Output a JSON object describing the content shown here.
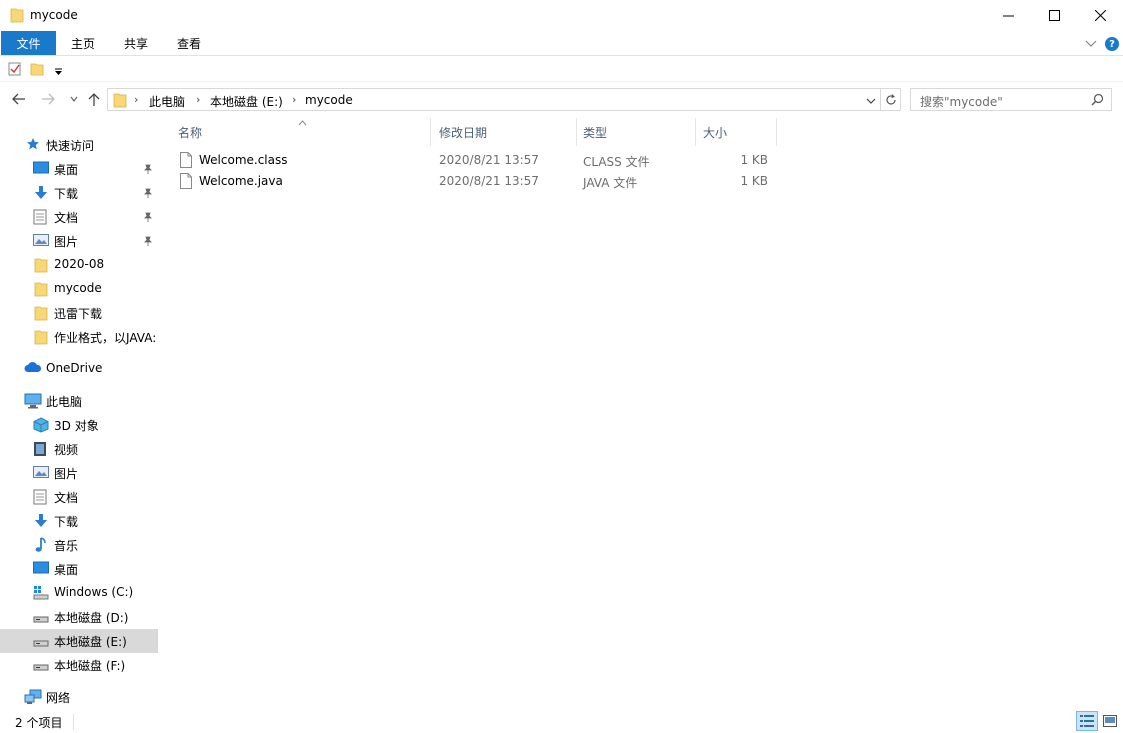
{
  "window": {
    "title": "mycode"
  },
  "ribbon": {
    "tabs": [
      {
        "label": "文件"
      },
      {
        "label": "主页"
      },
      {
        "label": "共享"
      },
      {
        "label": "查看"
      }
    ],
    "help_label": "?"
  },
  "address": {
    "crumbs": [
      "此电脑",
      "本地磁盘 (E:)",
      "mycode"
    ]
  },
  "search": {
    "placeholder": "搜索\"mycode\""
  },
  "sidebar": {
    "quick_access_label": "快速访问",
    "quick_items": [
      {
        "label": "桌面",
        "icon": "desktop-icon",
        "pinned": true
      },
      {
        "label": "下载",
        "icon": "download-icon",
        "pinned": true
      },
      {
        "label": "文档",
        "icon": "documents-icon",
        "pinned": true
      },
      {
        "label": "图片",
        "icon": "pictures-icon",
        "pinned": true
      },
      {
        "label": "2020-08",
        "icon": "folder-icon",
        "pinned": false
      },
      {
        "label": "mycode",
        "icon": "folder-icon",
        "pinned": false
      },
      {
        "label": "迅雷下载",
        "icon": "folder-icon",
        "pinned": false
      },
      {
        "label": "作业格式，以JAVA:",
        "icon": "folder-icon",
        "pinned": false
      }
    ],
    "onedrive_label": "OneDrive",
    "this_pc_label": "此电脑",
    "pc_items": [
      {
        "label": "3D 对象",
        "icon": "3d-objects-icon"
      },
      {
        "label": "视频",
        "icon": "videos-icon"
      },
      {
        "label": "图片",
        "icon": "pictures-icon"
      },
      {
        "label": "文档",
        "icon": "documents-icon"
      },
      {
        "label": "下载",
        "icon": "download-icon"
      },
      {
        "label": "音乐",
        "icon": "music-icon"
      },
      {
        "label": "桌面",
        "icon": "desktop-icon"
      },
      {
        "label": "Windows (C:)",
        "icon": "windows-drive-icon"
      },
      {
        "label": "本地磁盘 (D:)",
        "icon": "drive-icon"
      },
      {
        "label": "本地磁盘 (E:)",
        "icon": "drive-icon",
        "selected": true
      },
      {
        "label": "本地磁盘 (F:)",
        "icon": "drive-icon"
      }
    ],
    "network_label": "网络"
  },
  "columns": {
    "name": "名称",
    "modified": "修改日期",
    "type": "类型",
    "size": "大小"
  },
  "files": [
    {
      "name": "Welcome.class",
      "modified": "2020/8/21 13:57",
      "type": "CLASS 文件",
      "size": "1 KB"
    },
    {
      "name": "Welcome.java",
      "modified": "2020/8/21 13:57",
      "type": "JAVA 文件",
      "size": "1 KB"
    }
  ],
  "status": {
    "item_count": "2 个项目"
  },
  "colors": {
    "accent": "#1979ca",
    "folder": "#f8d775",
    "selection": "#d9d9d9",
    "column_header_text": "#4c607a"
  }
}
